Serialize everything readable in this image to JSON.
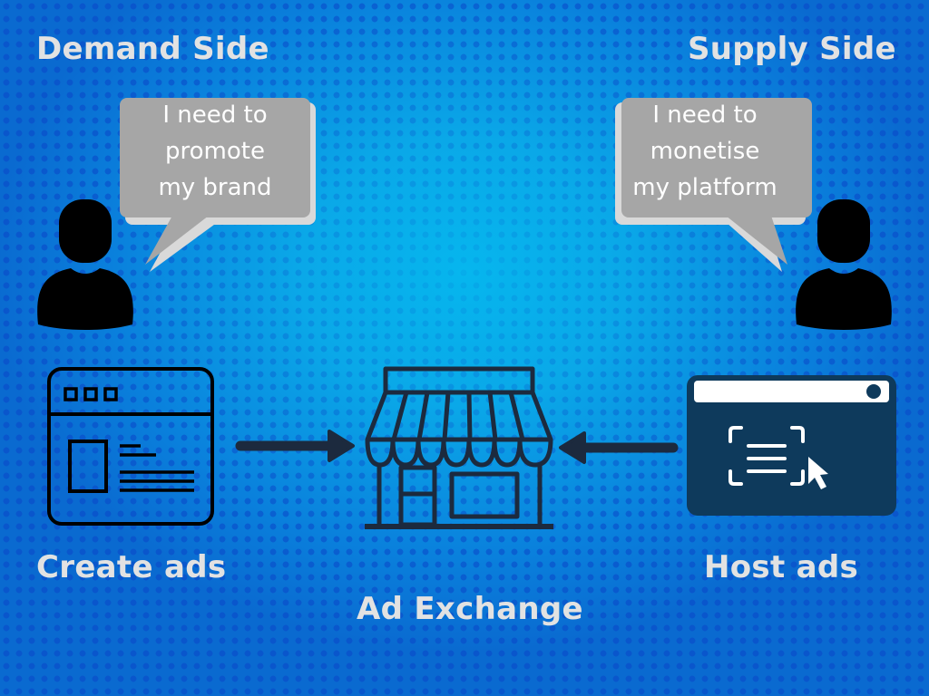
{
  "diagram": {
    "title_left": "Demand Side",
    "title_right": "Supply Side",
    "demand_bubble": {
      "lines": [
        "I need to",
        "promote",
        "my brand"
      ]
    },
    "supply_bubble": {
      "lines": [
        "I need to",
        "monetise",
        "my platform"
      ]
    },
    "labels": {
      "create_ads": "Create ads",
      "host_ads": "Host ads",
      "ad_exchange": "Ad Exchange"
    },
    "icons": {
      "demand_person": "person-icon",
      "supply_person": "person-icon",
      "create_ads": "browser-window-icon",
      "exchange": "storefront-icon",
      "host_ads": "web-ad-click-icon",
      "arrow_in_left": "arrow-right-icon",
      "arrow_in_right": "arrow-left-icon"
    },
    "colors": {
      "background_center": "#06b6ee",
      "background_edge": "#0a6ad0",
      "heading_text": "#e2e2e2",
      "bubble_fill": "#a6a6a6",
      "bubble_shadow": "#d9d9d9",
      "icon_dark": "#1c2a3e",
      "host_panel": "#0e3a5c"
    }
  }
}
